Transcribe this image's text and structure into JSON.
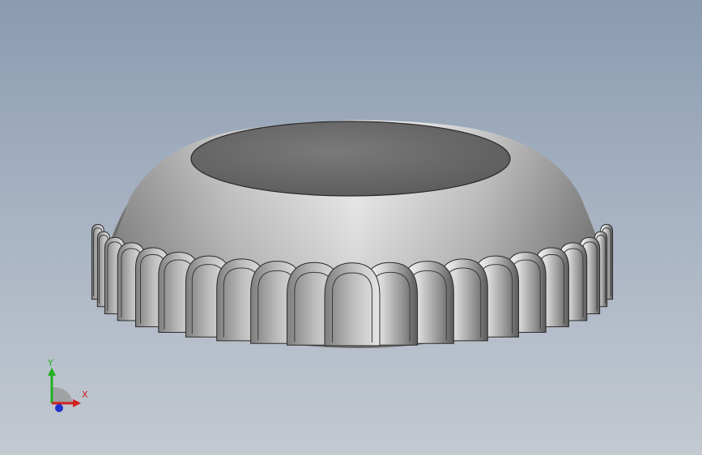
{
  "viewport": {
    "background_top": "#8a9bb0",
    "background_bottom": "#c3c9d1"
  },
  "model": {
    "name": "bottle-cap",
    "flute_count": 21,
    "body_color": "#b8b8b8",
    "top_color": "#6b6b6b"
  },
  "triad": {
    "x_label": "X",
    "y_label": "Y",
    "x_color": "#d02020",
    "y_color": "#20b020",
    "z_color": "#2030d0"
  }
}
